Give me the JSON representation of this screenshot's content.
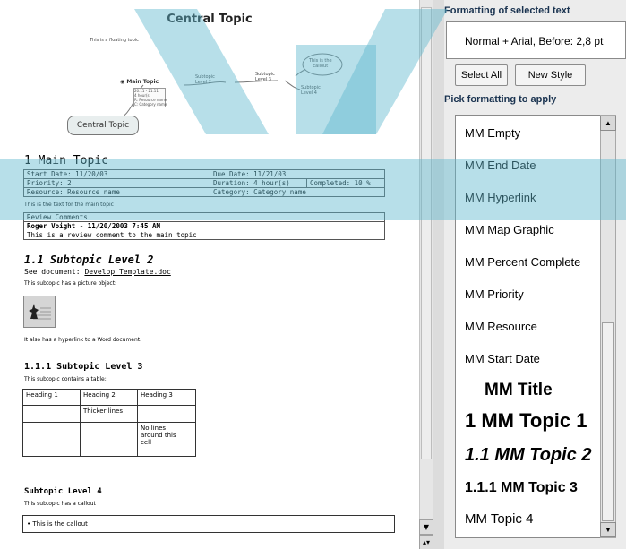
{
  "doc": {
    "map_title": "Central Topic",
    "floating_topic": "This is a floating topic",
    "map": {
      "central": "Central Topic",
      "main": "Main Topic",
      "main_details": [
        "20.11 - 21.11",
        "4 hour(s)",
        "R: Resource name",
        "C: Category name"
      ],
      "sub2_line1": "Subtopic",
      "sub2_line2": "Level 2",
      "sub3_line1": "Subtopic",
      "sub3_line2": "Level 3",
      "sub4_line1": "Subtopic",
      "sub4_line2": "Level 4",
      "callout_line1": "This is the",
      "callout_line2": "callout"
    },
    "heading1": "1 Main Topic",
    "props": {
      "start_date": "Start Date: 11/20/03",
      "due_date": "Due Date: 11/21/03",
      "priority": "Priority: 2",
      "duration": "Duration: 4 hour(s)",
      "completed": "Completed: 10 %",
      "resource": "Resource: Resource name",
      "category": "Category: Category name"
    },
    "main_text": "This is the text for the main topic",
    "review": {
      "header": "Review Comments",
      "author": "Roger Voight - 11/20/2003 7:45 AM",
      "comment": "This is a review comment to the main topic"
    },
    "heading2": "1.1 Subtopic Level 2",
    "see_doc_prefix": "See document: ",
    "see_doc_link": "Develop Template.doc",
    "picture_text": "This subtopic has a picture object:",
    "hyperlink_text": "It also has a hyperlink to a Word document.",
    "heading3": "1.1.1 Subtopic Level 3",
    "table_intro": "This subtopic contains a table:",
    "table": {
      "headers": [
        "Heading 1",
        "Heading 2",
        "Heading 3"
      ],
      "row2_col2": "Thicker lines",
      "row3_col3_line1": "No lines",
      "row3_col3_line2": "around this",
      "row3_col3_line3": "cell"
    },
    "heading4": "Subtopic Level 4",
    "callout_intro": "This subtopic has a callout",
    "callout_item": "• This is the callout"
  },
  "panel": {
    "formatting_title": "Formatting of selected text",
    "formatting_value": "Normal + Arial, Before:  2,8 pt",
    "select_all": "Select All",
    "new_style": "New Style",
    "pick_title": "Pick formatting to apply",
    "pilcrow": "¶",
    "styles": [
      "MM Empty",
      "MM End Date",
      "MM Hyperlink",
      "MM Map Graphic",
      "MM Percent Complete",
      "MM Priority",
      "MM Resource",
      "MM Start Date",
      "MM Title",
      "1  MM Topic 1",
      "1.1  MM Topic 2",
      "1.1.1  MM Topic 3",
      "MM Topic 4"
    ]
  },
  "colors": {
    "watermark": "#5fb8cf",
    "panel_heading": "#1a3350"
  }
}
